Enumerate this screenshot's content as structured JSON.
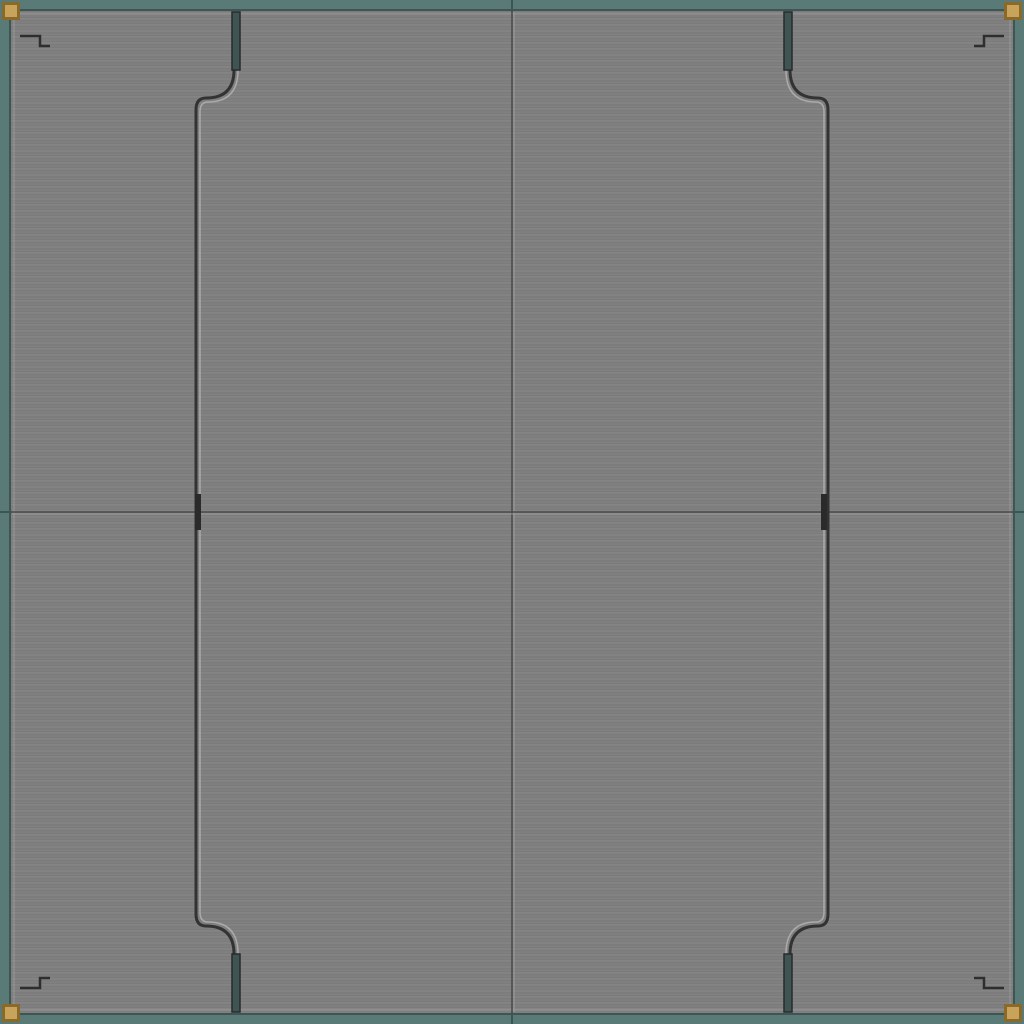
{
  "board": {
    "frame_color": "#5a7a77",
    "frame_inner_color": "#3e5553",
    "floor_color": "#7f7f7f",
    "floor_light_color": "#858585",
    "floor_dark_color": "#7a7a7a",
    "line_color": "#3a3a3a",
    "line_highlight_color": "#b0b0b0",
    "corner_stud_color": "#c8a35a",
    "corner_stud_dark_color": "#8a6a2a",
    "corner_studs": [
      {
        "name": "corner-stud-top-left-icon"
      },
      {
        "name": "corner-stud-top-right-icon"
      },
      {
        "name": "corner-stud-bottom-left-icon"
      },
      {
        "name": "corner-stud-bottom-right-icon"
      }
    ]
  }
}
